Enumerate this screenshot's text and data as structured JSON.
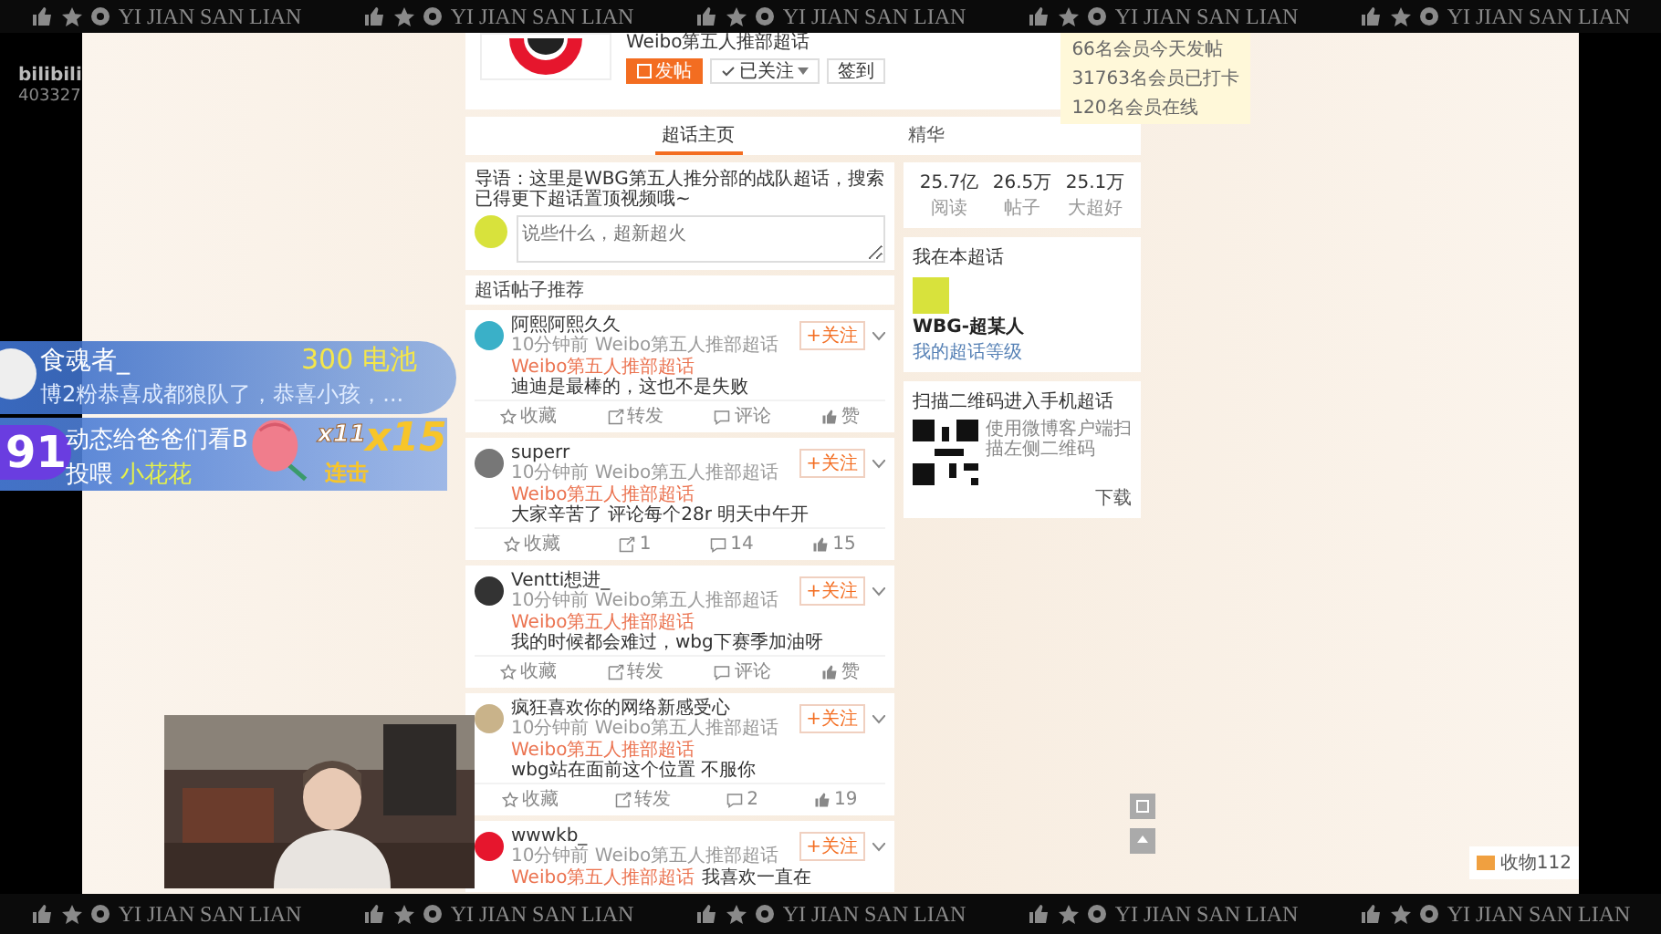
{
  "frame": {
    "top_band": [
      "YI JIAN SAN LIAN",
      "YI JIAN SAN LIAN",
      "YI JIAN SAN LIAN",
      "YI JIAN SAN LIAN",
      "YI JIAN SAN LIAN"
    ],
    "bottom_band": [
      "YI JIAN SAN LIAN",
      "YI JIAN SAN LIAN",
      "YI JIAN SAN LIAN",
      "YI JIAN SAN LIAN",
      "YI JIAN SAN LIAN"
    ]
  },
  "stream": {
    "logo": "bilibili",
    "room_id": "403327"
  },
  "header": {
    "title": "Weibo第五人推部超话",
    "buttons": [
      {
        "label": "发帖",
        "kind": "primary"
      },
      {
        "label": "已关注",
        "kind": "dropdown"
      },
      {
        "label": "签到",
        "kind": "plain"
      }
    ],
    "notices": [
      "66名会员今天发帖",
      "31763名会员已打卡",
      "120名会员在线"
    ]
  },
  "tabs": [
    {
      "label": "超话主页",
      "selected": true
    },
    {
      "label": "精华",
      "selected": false
    }
  ],
  "intro": {
    "text": "导语：这里是WBG第五人推分部的战队超话，搜索已得更下超话置顶视频哦~",
    "placeholder": "说些什么，超新超火"
  },
  "section_title": "超话帖子推荐",
  "posts": [
    {
      "name": "阿熙阿熙久久",
      "meta": "10分钟前 Weibo第五人推部超话",
      "topic": "Weibo第五人推部超话",
      "text": "迪迪是最棒的，这也不是失败",
      "follow": "+关注",
      "actions": [
        "收藏",
        "转发",
        "评论",
        "赞"
      ]
    },
    {
      "name": "superr",
      "meta": "10分钟前 Weibo第五人推部超话",
      "topic": "Weibo第五人推部超话",
      "text": "大家辛苦了 评论每个28r 明天中午开",
      "follow": "+关注",
      "actions": [
        "收藏",
        "1",
        "14",
        "15"
      ]
    },
    {
      "name": "Ventti想进_",
      "meta": "10分钟前 Weibo第五人推部超话",
      "topic": "Weibo第五人推部超话",
      "text": "我的时候都会难过，wbg下赛季加油呀",
      "follow": "+关注",
      "actions": [
        "收藏",
        "转发",
        "评论",
        "赞"
      ]
    },
    {
      "name": "疯狂喜欢你的网络新感受心",
      "meta": "10分钟前 Weibo第五人推部超话",
      "topic": "Weibo第五人推部超话",
      "text": "wbg站在面前这个位置 不服你",
      "follow": "+关注",
      "actions": [
        "收藏",
        "转发",
        "2",
        "19"
      ]
    },
    {
      "name": "wwwkb_",
      "meta": "10分钟前 Weibo第五人推部超话",
      "topic": "Weibo第五人推部超话",
      "text": "我喜欢一直在",
      "follow": "+关注"
    }
  ],
  "sidebar": {
    "stats": [
      {
        "value": "25.7亿",
        "label": "阅读"
      },
      {
        "value": "26.5万",
        "label": "帖子"
      },
      {
        "value": "25.1万",
        "label": "大超好"
      }
    ],
    "member": {
      "title": "我在本超话",
      "name": "WBG-超某人",
      "line": "我的超话等级"
    },
    "qr": {
      "title": "扫描二维码进入手机超话",
      "text": "使用微博客户端扫描左侧二维码",
      "download": "下载"
    }
  },
  "corner_notice": "收物112",
  "chat": {
    "name": "食魂者_",
    "message": "博2粉恭喜成都狼队了，恭喜小孩，...",
    "reward": "300 电池",
    "badge": "91",
    "gift_line": "动态给爸爸们看B",
    "gift_action": "投喂",
    "gift_name": "小花花",
    "combo_small": "x11",
    "combo": "x15",
    "combo_label": "连击"
  }
}
